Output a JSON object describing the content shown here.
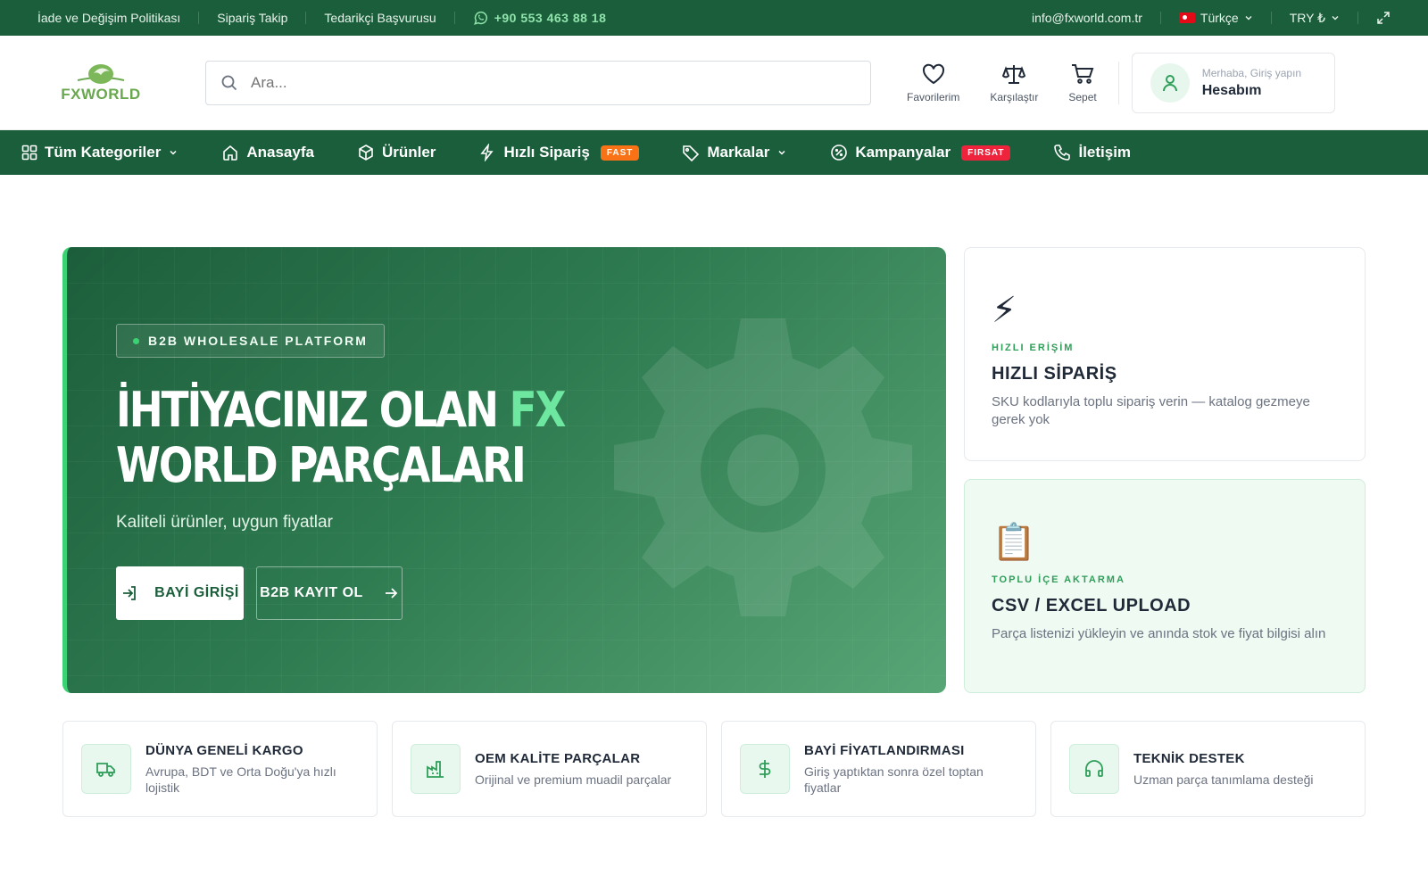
{
  "topbar": {
    "links": [
      "İade ve Değişim Politikası",
      "Sipariş Takip",
      "Tedarikçi Başvurusu"
    ],
    "phone": "+90 553 463 88 18",
    "email": "info@fxworld.com.tr",
    "language": "Türkçe",
    "currency": "TRY ₺"
  },
  "header": {
    "logo_text": "FXWORLD",
    "search_placeholder": "Ara...",
    "favorites_label": "Favorilerim",
    "compare_label": "Karşılaştır",
    "cart_label": "Sepet",
    "account_greeting": "Merhaba, Giriş yapın",
    "account_label": "Hesabım"
  },
  "nav": {
    "items": [
      {
        "label": "Tüm Kategoriler",
        "icon": "grid-icon"
      },
      {
        "label": "Anasayfa",
        "icon": "home-icon"
      },
      {
        "label": "Ürünler",
        "icon": "box-icon"
      },
      {
        "label": "Hızlı Sipariş",
        "icon": "bolt-icon",
        "badge": "FAST"
      },
      {
        "label": "Markalar",
        "icon": "tag-icon"
      },
      {
        "label": "Kampanyalar",
        "icon": "percent-icon",
        "badge": "FIRSAT"
      },
      {
        "label": "İletişim",
        "icon": "phone-icon"
      }
    ]
  },
  "hero": {
    "tag": "B2B WHOLESALE PLATFORM",
    "title_part1": "İHTİYACINIZ OLAN ",
    "title_accent": "FX",
    "title_part2": " WORLD PARÇALARI",
    "subtitle": "Kaliteli ürünler, uygun fiyatlar",
    "login_button": "BAYİ GİRİŞİ",
    "register_button": "B2B KAYIT OL"
  },
  "side_cards": [
    {
      "emoji": "⚡",
      "tag": "HIZLI ERİŞİM",
      "title": "HIZLI SİPARİŞ",
      "desc": "SKU kodlarıyla toplu sipariş verin — katalog gezmeye gerek yok"
    },
    {
      "emoji": "📋",
      "tag": "TOPLU İÇE AKTARMA",
      "title": "CSV / EXCEL UPLOAD",
      "desc": "Parça listenizi yükleyin ve anında stok ve fiyat bilgisi alın"
    }
  ],
  "features": [
    {
      "title": "DÜNYA GENELİ KARGO",
      "desc": "Avrupa, BDT ve Orta Doğu'ya hızlı lojistik",
      "icon": "truck-icon"
    },
    {
      "title": "OEM KALİTE PARÇALAR",
      "desc": "Orijinal ve premium muadil parçalar",
      "icon": "factory-icon"
    },
    {
      "title": "BAYİ FİYATLANDIRMASI",
      "desc": "Giriş yaptıktan sonra özel toptan fiyatlar",
      "icon": "dollar-icon"
    },
    {
      "title": "TEKNİK DESTEK",
      "desc": "Uzman parça tanımlama desteği",
      "icon": "headset-icon"
    }
  ],
  "colors": {
    "primary": "#1b5e3b",
    "accent": "#3ad272",
    "badge_fast": "#f97316",
    "badge_firsat": "#ef233c"
  }
}
